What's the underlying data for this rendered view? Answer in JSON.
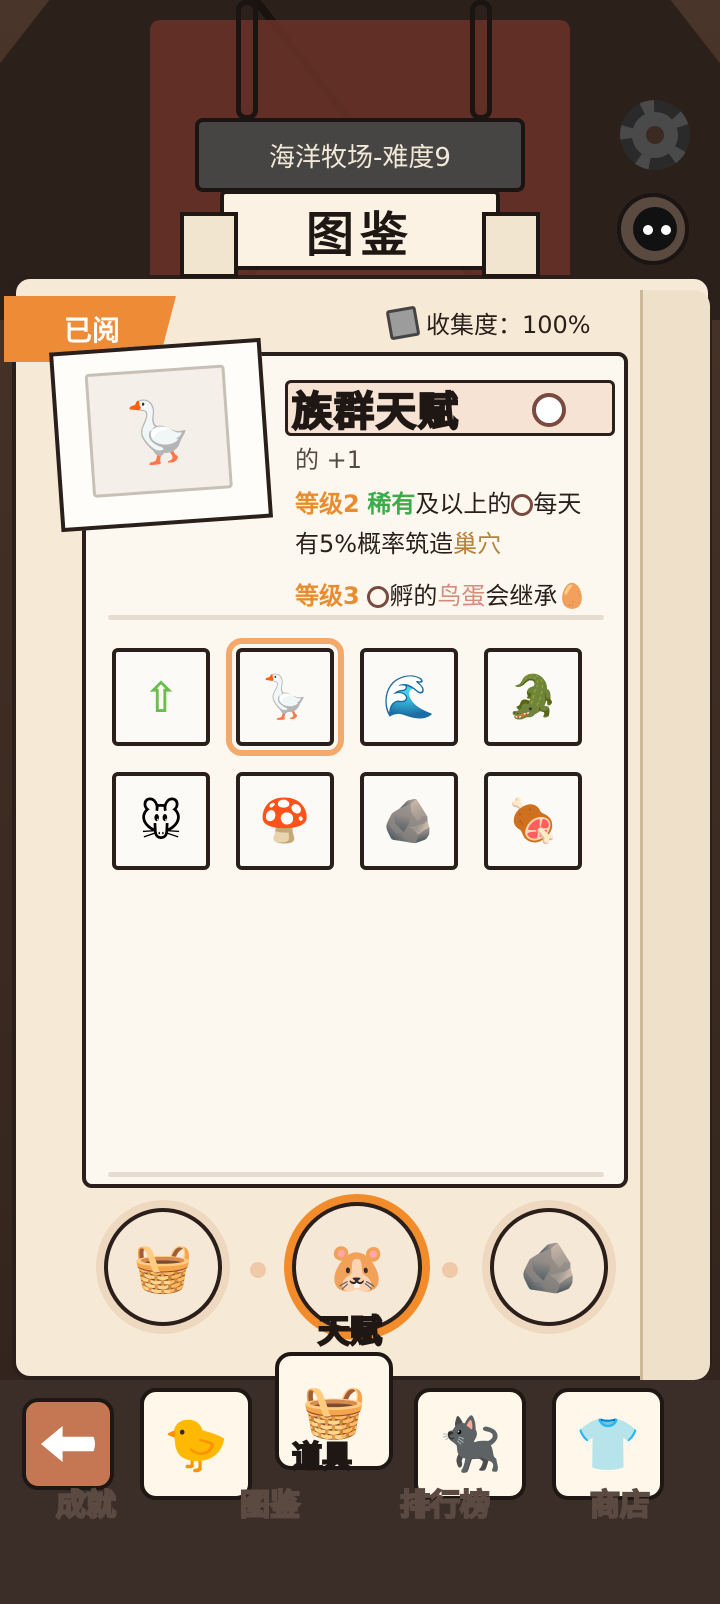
{
  "header": {
    "stage_name": "海洋牧场-难度9",
    "title": "图鉴"
  },
  "book": {
    "read_tab": "已阅",
    "collection_label": "收集度：100%"
  },
  "talent": {
    "name": "族群天赋",
    "line_partial": "的  +1",
    "level2_prefix": "等级2",
    "level2_rare": "稀有",
    "level2_text": "及以上的",
    "level2_text2": "每天",
    "level2_line2_a": "有5%概率筑造",
    "level2_line2_b": "巢穴",
    "level3_prefix": "等级3",
    "level3_text": "孵的",
    "level3_egg": "鸟蛋",
    "level3_text2": "会继承"
  },
  "grid_items": [
    {
      "name": "green-arrows-icon",
      "glyph": "⇧",
      "selected": false
    },
    {
      "name": "geese-plus-one-icon",
      "glyph": "🪿",
      "selected": true
    },
    {
      "name": "wave-icon",
      "glyph": "🌊",
      "selected": false
    },
    {
      "name": "crocodile-icon",
      "glyph": "🐊",
      "selected": false
    },
    {
      "name": "mice-icon",
      "glyph": "🐭",
      "selected": false
    },
    {
      "name": "mushroom-icon",
      "glyph": "🍄",
      "selected": false
    },
    {
      "name": "rocks-icon",
      "glyph": "🪨",
      "selected": false
    },
    {
      "name": "meat-icon",
      "glyph": "🍖",
      "selected": false
    }
  ],
  "categories": {
    "active_label": "天赋"
  },
  "nav": {
    "items": [
      {
        "label": "成就"
      },
      {
        "label": "图鉴"
      },
      {
        "label": "道具"
      },
      {
        "label": "排行榜"
      },
      {
        "label": "商店"
      }
    ]
  }
}
